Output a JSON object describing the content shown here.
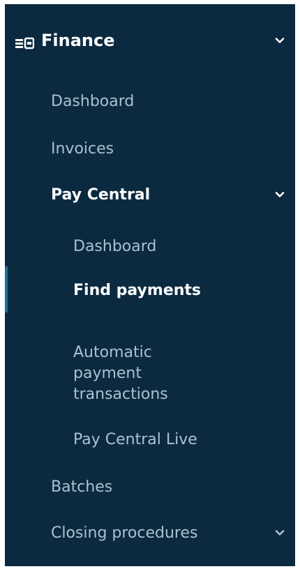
{
  "nav": {
    "section": "Finance",
    "items": [
      {
        "label": "Dashboard"
      },
      {
        "label": "Invoices"
      },
      {
        "label": "Pay Central"
      }
    ],
    "pay_central_items": [
      {
        "label": "Dashboard"
      },
      {
        "label": "Find payments"
      },
      {
        "label": "Automatic\npayment\ntransactions"
      },
      {
        "label": "Pay Central Live"
      }
    ],
    "bottom_items": [
      {
        "label": "Batches"
      },
      {
        "label": "Closing procedures"
      }
    ]
  },
  "colors": {
    "background": "#0b2a40",
    "text": "#a9c2cf",
    "active_text": "#ffffff",
    "indicator": "#1a6f9a"
  },
  "icons": {
    "section": "finance-icon",
    "expand": "chevron-down-icon"
  }
}
